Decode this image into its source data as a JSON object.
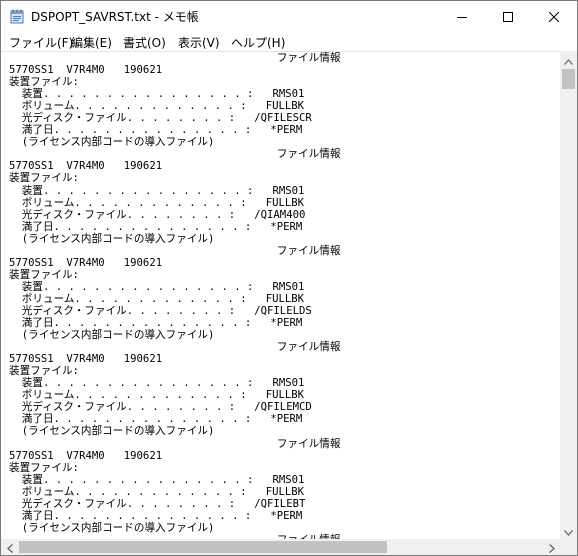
{
  "window": {
    "title": "DSPOPT_SAVRST.txt - メモ帳"
  },
  "menu": [
    {
      "label": "ファイル(F)"
    },
    {
      "label": "編集(E)"
    },
    {
      "label": "書式(O)"
    },
    {
      "label": "表示(V)"
    },
    {
      "label": "ヘルプ(H)"
    }
  ],
  "document": {
    "lines": [
      "                                          ファイル情報",
      "5770SS1  V7R4M0   190621",
      "装置ファイル:",
      "  装置. . . . . . . . . . . . . . . . :   RMS01",
      "  ボリューム. . . . . . . . . . . . . :   FULLBK",
      "  光ディスク・ファイル. . . . . . . . :   /QFILESCR",
      "  満了日. . . . . . . . . . . . . . . :   *PERM",
      "  (ライセンス内部コードの導入ファイル)",
      "                                          ファイル情報",
      "5770SS1  V7R4M0   190621",
      "装置ファイル:",
      "  装置. . . . . . . . . . . . . . . . :   RMS01",
      "  ボリューム. . . . . . . . . . . . . :   FULLBK",
      "  光ディスク・ファイル. . . . . . . . :   /QIAM400",
      "  満了日. . . . . . . . . . . . . . . :   *PERM",
      "  (ライセンス内部コードの導入ファイル)",
      "                                          ファイル情報",
      "5770SS1  V7R4M0   190621",
      "装置ファイル:",
      "  装置. . . . . . . . . . . . . . . . :   RMS01",
      "  ボリューム. . . . . . . . . . . . . :   FULLBK",
      "  光ディスク・ファイル. . . . . . . . :   /QFILELDS",
      "  満了日. . . . . . . . . . . . . . . :   *PERM",
      "  (ライセンス内部コードの導入ファイル)",
      "                                          ファイル情報",
      "5770SS1  V7R4M0   190621",
      "装置ファイル:",
      "  装置. . . . . . . . . . . . . . . . :   RMS01",
      "  ボリューム. . . . . . . . . . . . . :   FULLBK",
      "  光ディスク・ファイル. . . . . . . . :   /QFILEMCD",
      "  満了日. . . . . . . . . . . . . . . :   *PERM",
      "  (ライセンス内部コードの導入ファイル)",
      "                                          ファイル情報",
      "5770SS1  V7R4M0   190621",
      "装置ファイル:",
      "  装置. . . . . . . . . . . . . . . . :   RMS01",
      "  ボリューム. . . . . . . . . . . . . :   FULLBK",
      "  光ディスク・ファイル. . . . . . . . :   /QFILEBT",
      "  満了日. . . . . . . . . . . . . . . :   *PERM",
      "  (ライセンス内部コードの導入ファイル)",
      "                                          ファイル情報"
    ]
  },
  "icons": {
    "app": "notepad-icon",
    "minimize": "minimize-icon",
    "maximize": "maximize-icon",
    "close": "close-icon"
  }
}
